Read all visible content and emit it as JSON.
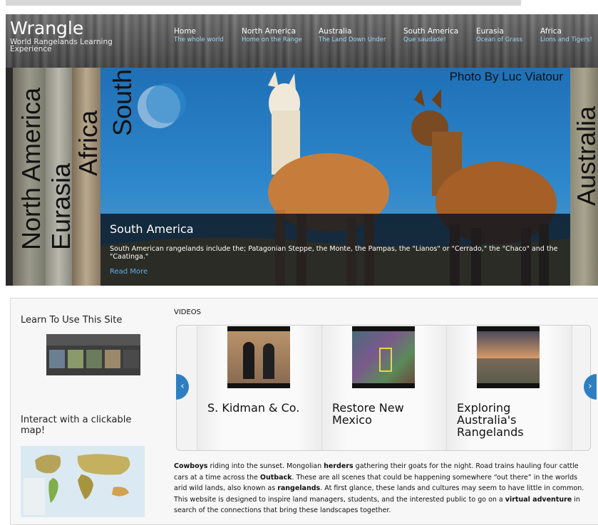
{
  "header": {
    "logo": "Wrangle",
    "tagline": "World Rangelands Learning Experience",
    "nav": [
      {
        "title": "Home",
        "subtitle": "The whole world"
      },
      {
        "title": "North America",
        "subtitle": "Home on the Range"
      },
      {
        "title": "Australia",
        "subtitle": "The Land Down Under"
      },
      {
        "title": "South America",
        "subtitle": "Que saudade!"
      },
      {
        "title": "Eurasia",
        "subtitle": "Ocean of Grass"
      },
      {
        "title": "Africa",
        "subtitle": "Lions and Tigers!"
      }
    ]
  },
  "slider": {
    "panels": [
      "North America",
      "Eurasia",
      "Africa",
      "South America",
      "Australia"
    ],
    "photo_credit": "Photo By Luc Viatour",
    "caption_title": "South America",
    "caption_text": "South American rangelands include the; Patagonian Steppe, the Monte, the Pampas, the \"Lianos\" or \"Cerrado,\" the \"Chaco\" and the \"Caatinga.\"",
    "read_more": "Read More"
  },
  "sidebar": {
    "learn_heading": "Learn To Use This Site",
    "map_heading": "Interact with a clickable map!"
  },
  "videos": {
    "label": "VIDEOS",
    "items": [
      {
        "title": "S. Kidman & Co."
      },
      {
        "title": "Restore New Mexico"
      },
      {
        "title": "Exploring Australia's Rangelands"
      }
    ]
  },
  "intro": {
    "cowboys": "Cowboys",
    "t1": " riding into the sunset. Mongolian ",
    "herders": "herders",
    "t2": " gathering their goats for the night. Road trains hauling four cattle cars at a time across the ",
    "outback": "Outback",
    "t3": ". These are all scenes that could be happening somewhere “out there” in the worlds arid wild lands, also known as ",
    "rangelands": "rangelands",
    "t4": ". At first glance, these lands and cultures may seem to have little in common. This website is designed to inspire land managers, students, and the interested public to go on a ",
    "virtual": "virtual adventure",
    "t5": " in search of the connections that bring these landscapes together."
  },
  "colors": {
    "nav_subtitle": "#9fd4f2",
    "link": "#5ab0ee",
    "arrow": "#2f7ec2"
  }
}
